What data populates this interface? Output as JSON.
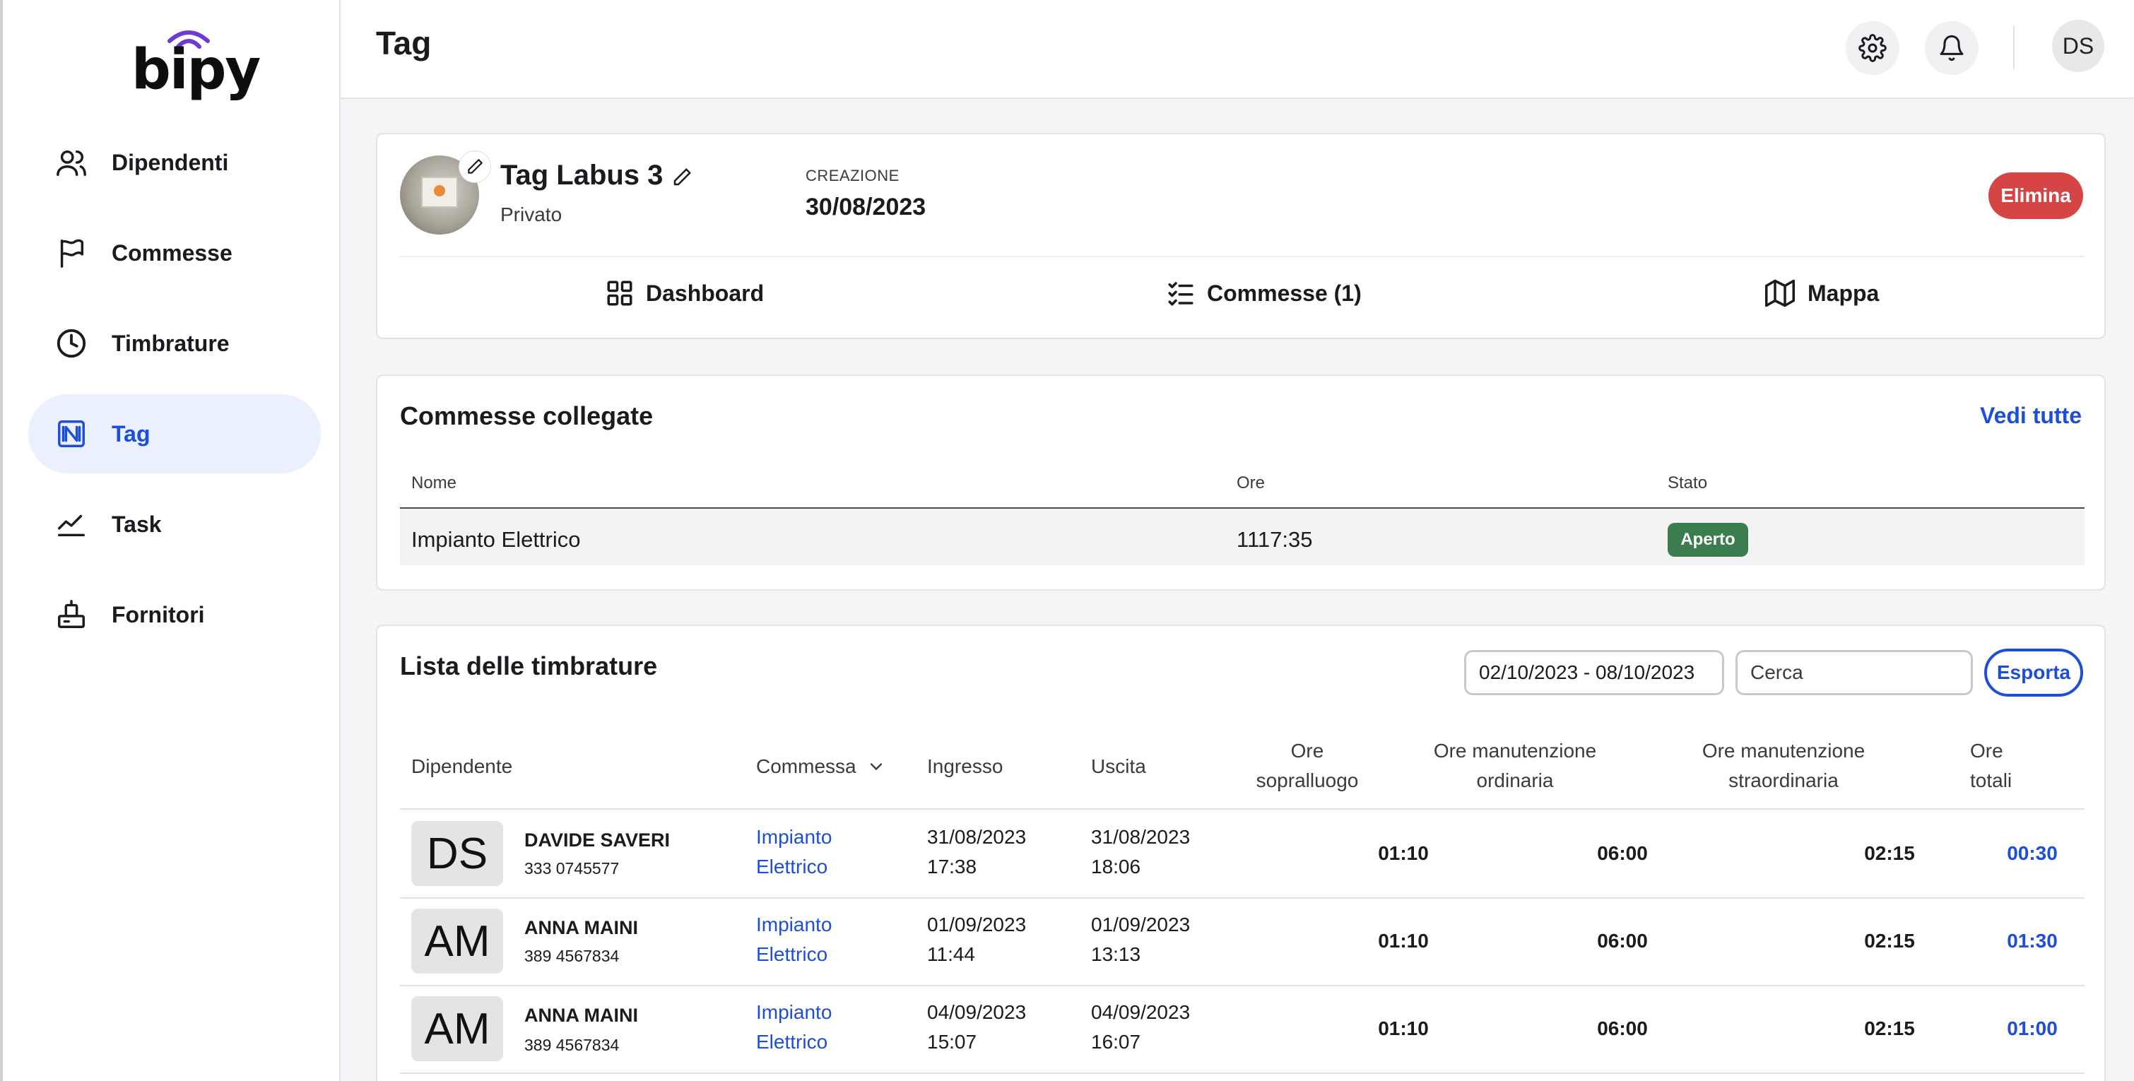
{
  "app": {
    "logo_text": "bipy"
  },
  "sidebar": {
    "items": [
      {
        "label": "Dipendenti",
        "icon": "users-icon",
        "active": false
      },
      {
        "label": "Commesse",
        "icon": "flag-icon",
        "active": false
      },
      {
        "label": "Timbrature",
        "icon": "clock-icon",
        "active": false
      },
      {
        "label": "Tag",
        "icon": "nfc-tag-icon",
        "active": true
      },
      {
        "label": "Task",
        "icon": "chart-line-icon",
        "active": false
      },
      {
        "label": "Fornitori",
        "icon": "supplier-icon",
        "active": false
      }
    ]
  },
  "header": {
    "title": "Tag",
    "user_initials": "DS"
  },
  "tag": {
    "name": "Tag Labus 3",
    "type": "Privato",
    "creation_label": "CREAZIONE",
    "creation_date": "30/08/2023",
    "delete_label": "Elimina",
    "tabs": [
      {
        "label": "Dashboard",
        "icon": "grid-icon"
      },
      {
        "label": "Commesse (1)",
        "icon": "checklist-icon"
      },
      {
        "label": "Mappa",
        "icon": "map-icon"
      }
    ]
  },
  "linked_jobs": {
    "title": "Commesse collegate",
    "see_all": "Vedi tutte",
    "columns": [
      "Nome",
      "Ore",
      "Stato"
    ],
    "rows": [
      {
        "name": "Impianto Elettrico",
        "hours": "1117:35",
        "status": "Aperto"
      }
    ]
  },
  "timesheets": {
    "title": "Lista delle timbrature",
    "date_range": "02/10/2023 - 08/10/2023",
    "search_placeholder": "Cerca",
    "export_label": "Esporta",
    "columns": {
      "employee": "Dipendente",
      "job": "Commessa",
      "entry": "Ingresso",
      "exit": "Uscita",
      "survey_1": "Ore",
      "survey_2": "sopralluogo",
      "ordinary_1": "Ore manutenzione",
      "ordinary_2": "ordinaria",
      "extra_1": "Ore manutenzione",
      "extra_2": "straordinaria",
      "total_1": "Ore",
      "total_2": "totali"
    },
    "rows": [
      {
        "initials": "DS",
        "name": "DAVIDE SAVERI",
        "phone": "333 0745577",
        "job_1": "Impianto",
        "job_2": "Elettrico",
        "entry_date": "31/08/2023",
        "entry_time": "17:38",
        "exit_date": "31/08/2023",
        "exit_time": "18:06",
        "survey": "01:10",
        "ordinary": "06:00",
        "extra": "02:15",
        "total": "00:30"
      },
      {
        "initials": "AM",
        "name": "ANNA MAINI",
        "phone": "389 4567834",
        "job_1": "Impianto",
        "job_2": "Elettrico",
        "entry_date": "01/09/2023",
        "entry_time": "11:44",
        "exit_date": "01/09/2023",
        "exit_time": "13:13",
        "survey": "01:10",
        "ordinary": "06:00",
        "extra": "02:15",
        "total": "01:30"
      },
      {
        "initials": "AM",
        "name": "ANNA MAINI",
        "phone": "389 4567834",
        "job_1": "Impianto",
        "job_2": "Elettrico",
        "entry_date": "04/09/2023",
        "entry_time": "15:07",
        "exit_date": "04/09/2023",
        "exit_time": "16:07",
        "survey": "01:10",
        "ordinary": "06:00",
        "extra": "02:15",
        "total": "01:00"
      }
    ]
  },
  "colors": {
    "accent": "#1d4ed8",
    "danger": "#d64545",
    "success": "#3b7d4f"
  }
}
